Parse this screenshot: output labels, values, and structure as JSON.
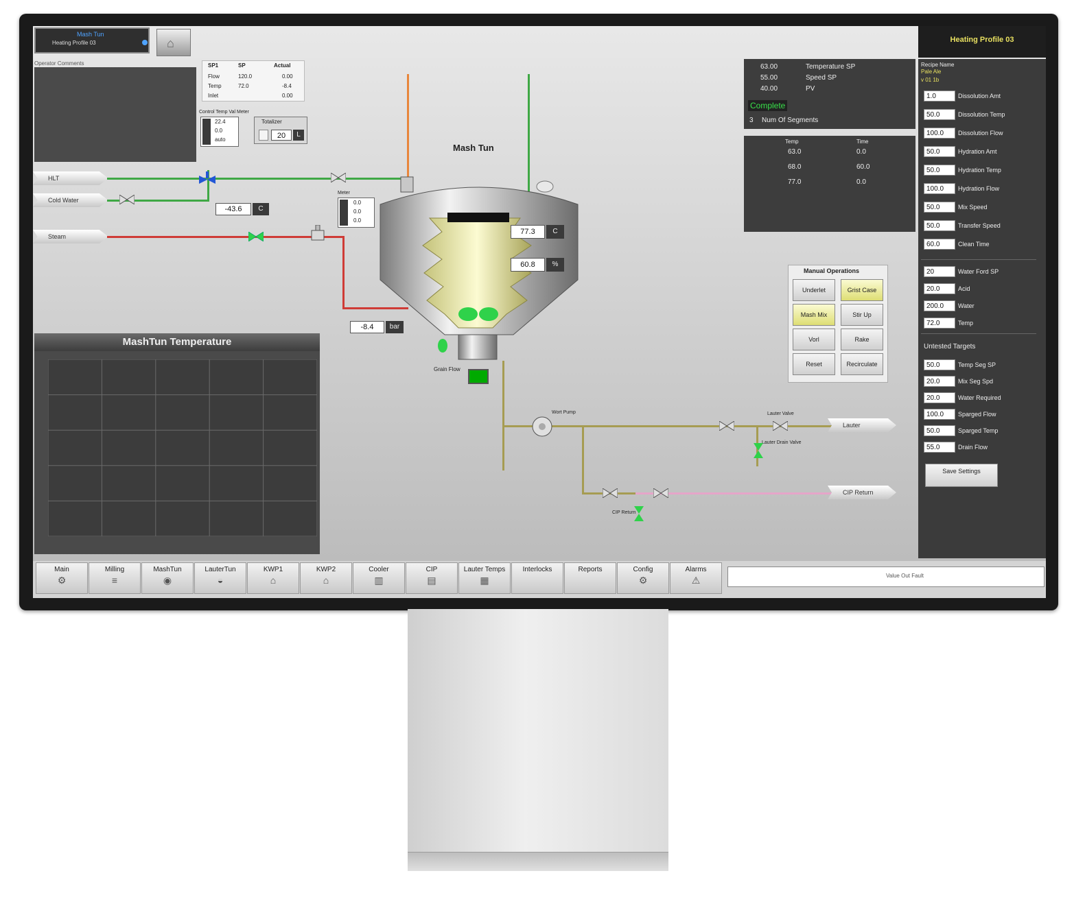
{
  "top_left": {
    "status_text": "Mash Tun",
    "status_sub": "Heating Profile 03"
  },
  "ops_label": "Operator Comments",
  "sp_table": {
    "headers": [
      "SP1",
      "SP",
      "Actual"
    ],
    "rows": [
      [
        "Flow",
        "120.0",
        "0.00"
      ],
      [
        "Temp",
        "72.0",
        "-8.4"
      ],
      [
        "Inlet",
        "",
        "0.00"
      ]
    ]
  },
  "control_temp": {
    "label": "Control Temp Val Meter",
    "values": [
      "22.4",
      "0.0",
      "auto"
    ]
  },
  "totalizer": {
    "label": "Totalizer",
    "value": "20",
    "unit": "L"
  },
  "inlets": {
    "hlt": "HLT",
    "cold": "Cold Water",
    "steam": "Steam"
  },
  "readouts": {
    "flow_value": "-43.6",
    "flow_unit": "C",
    "jacket_value": "-8.4",
    "jacket_unit": "bar",
    "tank_temp": "77.3",
    "tank_temp_unit": "C",
    "tank_level": "60.8",
    "tank_level_unit": "%"
  },
  "meter_box": {
    "label": "Meter",
    "values": [
      "0.0",
      "0.0",
      "0.0"
    ]
  },
  "tank": {
    "title": "Mash Tun",
    "outlet_label": "Grain Flow"
  },
  "chart": {
    "title": "MashTun Temperature"
  },
  "chart_data": {
    "type": "line",
    "title": "MashTun Temperature",
    "xlabel": "",
    "ylabel": "",
    "grid": true,
    "series": []
  },
  "profile": {
    "rows": [
      {
        "value": "63.00",
        "label": "Temperature SP"
      },
      {
        "value": "55.00",
        "label": "Speed SP"
      },
      {
        "value": "40.00",
        "label": "PV"
      }
    ],
    "status": "Complete",
    "segments_value": "3",
    "segments_label": "Num Of Segments",
    "table_headers": [
      "Temp",
      "Time"
    ],
    "table_rows": [
      [
        "63.0",
        "0.0"
      ],
      [
        "68.0",
        "60.0"
      ],
      [
        "77.0",
        "0.0"
      ]
    ]
  },
  "manual_ops": {
    "title": "Manual Operations",
    "buttons": [
      "Underlet",
      "Grist Case",
      "Mash Mix",
      "Stir Up",
      "Vorl",
      "Rake",
      "Reset",
      "Recirculate"
    ]
  },
  "lower_labels": {
    "pump": "Wort Pump",
    "lauter": "Lauter",
    "cip_return": "CIP Return",
    "valve_a": "Lauter Valve",
    "valve_b": "Lauter Drain Valve",
    "valve_c": "CIP Return"
  },
  "right_panel": {
    "header": "Heating Profile 03",
    "recipe_label": "Recipe Name",
    "recipe_value": "Pale Ale",
    "recipe_sub": "v 01 1b",
    "params": [
      {
        "value": "1.0",
        "label": "Dissolution Amt"
      },
      {
        "value": "50.0",
        "label": "Dissolution Temp"
      },
      {
        "value": "100.0",
        "label": "Dissolution Flow"
      },
      {
        "value": "50.0",
        "label": "Hydration Amt"
      },
      {
        "value": "50.0",
        "label": "Hydration Temp"
      },
      {
        "value": "100.0",
        "label": "Hydration Flow"
      },
      {
        "value": "50.0",
        "label": "Mix Speed"
      },
      {
        "value": "50.0",
        "label": "Transfer Speed"
      },
      {
        "value": "60.0",
        "label": "Clean Time"
      }
    ],
    "params2": [
      {
        "value": "20",
        "label": "Water Ford SP"
      },
      {
        "value": "20.0",
        "label": "Acid"
      },
      {
        "value": "200.0",
        "label": "Water"
      },
      {
        "value": "72.0",
        "label": "Temp"
      }
    ],
    "section_label": "Untested Targets",
    "params3": [
      {
        "value": "50.0",
        "label": "Temp Seg SP"
      },
      {
        "value": "20.0",
        "label": "Mix Seg Spd"
      },
      {
        "value": "20.0",
        "label": "Water Required"
      },
      {
        "value": "100.0",
        "label": "Sparged Flow"
      },
      {
        "value": "50.0",
        "label": "Sparged Temp"
      },
      {
        "value": "55.0",
        "label": "Drain Flow"
      }
    ],
    "save_button": "Save Settings"
  },
  "nav": [
    {
      "label": "Main",
      "icon": "⚙"
    },
    {
      "label": "Milling",
      "icon": "≡"
    },
    {
      "label": "MashTun",
      "icon": "◉"
    },
    {
      "label": "LauterTun",
      "icon": "◒"
    },
    {
      "label": "KWP1",
      "icon": "⌂"
    },
    {
      "label": "KWP2",
      "icon": "⌂"
    },
    {
      "label": "Cooler",
      "icon": "▥"
    },
    {
      "label": "CIP",
      "icon": "▤"
    },
    {
      "label": "Lauter Temps",
      "icon": "▦"
    },
    {
      "label": "Interlocks",
      "icon": ""
    },
    {
      "label": "Reports",
      "icon": ""
    },
    {
      "label": "Config",
      "icon": "⚙"
    },
    {
      "label": "Alarms",
      "icon": "⚠"
    }
  ],
  "alarm_bar": {
    "text": "Value Out Fault"
  },
  "colors": {
    "green_pipe": "#3fa845",
    "red_pipe": "#cf3b36",
    "olive_pipe": "#a69c52",
    "pink_pipe": "#e6a5c9",
    "orange_pipe": "#e8863b",
    "panel": "#434343",
    "accent_yellow": "#e8e060"
  }
}
